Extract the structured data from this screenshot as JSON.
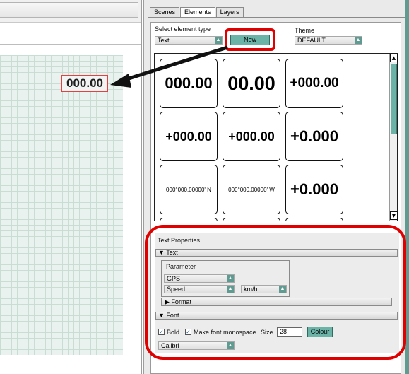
{
  "tabs": [
    {
      "label": "Scenes",
      "active": false
    },
    {
      "label": "Elements",
      "active": true
    },
    {
      "label": "Layers",
      "active": false
    }
  ],
  "element_type": {
    "label": "Select element type",
    "value": "Text"
  },
  "new_button": "New",
  "theme": {
    "label": "Theme",
    "value": "DEFAULT"
  },
  "canvas_element": "000.00",
  "gallery": [
    "000.00",
    "00.00",
    "+000.00",
    "+000.00",
    "+000.00",
    "+0.000",
    "000°000.00000' N",
    "000°000.00000' W",
    "+0.000"
  ],
  "text_properties": {
    "title": "Text Properties",
    "text_section": "Text",
    "parameter_label": "Parameter",
    "parameter_value": "GPS",
    "subparam_value": "Speed",
    "unit_value": "km/h",
    "format_section": "Format",
    "font_section": "Font",
    "bold_label": "Bold",
    "bold_checked": true,
    "monospace_label": "Make font monospace",
    "monospace_checked": true,
    "size_label": "Size",
    "size_value": "28",
    "colour_button": "Colour",
    "font_value": "Calibri"
  },
  "colors": {
    "accent": "#6ab3a6",
    "callout": "#e10000",
    "grid": "#e9f2ee"
  },
  "icons": {
    "dropdown": "dropdown-arrow-icon",
    "expanded": "triangle-down-icon",
    "collapsed": "triangle-right-icon"
  }
}
